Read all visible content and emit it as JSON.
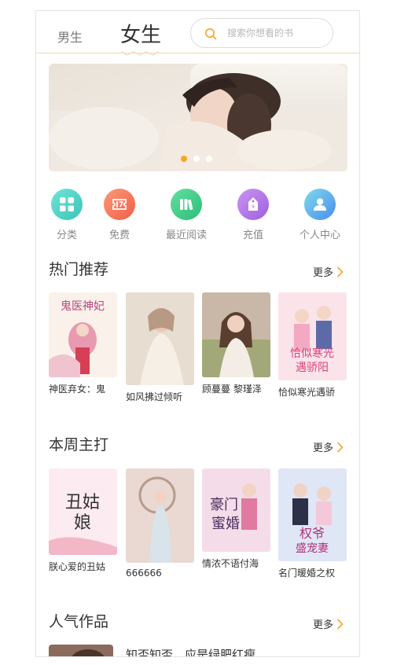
{
  "header": {
    "tab_male": "男生",
    "tab_female": "女生",
    "search_placeholder": "搜索你想看的书"
  },
  "banner": {
    "slide_count": 3,
    "active_slide": 1,
    "accent": "#f5a623"
  },
  "categories": [
    {
      "label": "分类",
      "icon": "grid-icon",
      "color": "#4dd5c8"
    },
    {
      "label": "免费",
      "icon": "ticket-icon",
      "color": "#f77a5a"
    },
    {
      "label": "最近阅读",
      "icon": "books-icon",
      "color": "#3fcf8b"
    },
    {
      "label": "充值",
      "icon": "price-tag-icon",
      "color": "#b679e8"
    },
    {
      "label": "个人中心",
      "icon": "user-icon",
      "color": "#57a9f2"
    }
  ],
  "sections": [
    {
      "title": "热门推荐",
      "more": "更多",
      "books": [
        {
          "title": "神医弃女：鬼",
          "cover": "#f7e6d8"
        },
        {
          "title": "如风拂过倾听",
          "cover": "#e8dccd"
        },
        {
          "title": "顾蔓蔓 黎瑾泽",
          "cover": "#d9c6b8"
        },
        {
          "title": "恰似寒光遇骄",
          "cover": "#f6c8d4"
        }
      ]
    },
    {
      "title": "本周主打",
      "more": "更多",
      "books": [
        {
          "title": "朕心爱的丑姑",
          "cover": "#f9dde6"
        },
        {
          "title": "666666",
          "cover": "#e6d3cc"
        },
        {
          "title": "情浓不语付海",
          "cover": "#f2dbe8"
        },
        {
          "title": "名门暖婚之权",
          "cover": "#d7dff3"
        }
      ]
    },
    {
      "title": "人气作品",
      "more": "更多",
      "books": [
        {
          "title": "知否知否，应是绿肥红瘦",
          "cover": "#8a6a5a"
        }
      ]
    }
  ]
}
